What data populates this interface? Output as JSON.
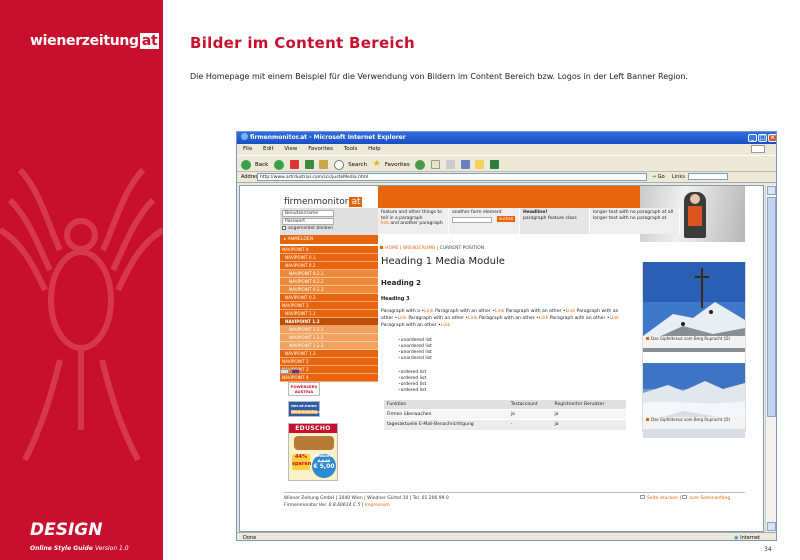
{
  "brand": {
    "logo_main": "wienerzeitung",
    "logo_suffix": "at"
  },
  "slide": {
    "title": "Bilder im Content Bereich",
    "description": "Die Homepage mit einem Beispiel für die Verwendung von Bildern im Content Bereich bzw. Logos in der Left Banner Region.",
    "design_label": "DESIGN",
    "guide_label": "Online Style Guide",
    "version": "Version 1.0",
    "page_number": "34"
  },
  "browser": {
    "title": "firmenmonitor.at - Microsoft Internet Explorer",
    "menu": [
      "File",
      "Edit",
      "View",
      "Favorites",
      "Tools",
      "Help"
    ],
    "toolbar": {
      "back": "Back",
      "search": "Search",
      "favorites": "Favorites"
    },
    "address_label": "Address",
    "address_value": "http://www.artrdustrial.com/scs/justeMedia.html",
    "go_label": "Go",
    "links_label": "Links",
    "status_text": "Done",
    "status_zone": "Internet"
  },
  "site": {
    "logo_main": "firmenmonitor",
    "logo_suffix": "at",
    "login": {
      "username_placeholder": "Benutzername",
      "password_placeholder": "Passwort",
      "remember": "angemeldet bleiben",
      "button": "ANMELDEN"
    },
    "teasers": [
      {
        "text": "feature and other things to tell in a paragraph",
        "link": "link",
        "tail": "and another paragraph"
      },
      {
        "text": "another form element",
        "button": "suchen"
      },
      {
        "title": "Headline!",
        "text": "paragraph feature class"
      },
      {
        "text": "longer text with no paragraph at all longer text with no paragraph at"
      }
    ],
    "breadcrumb": {
      "home": "HOME",
      "bread": "BREADCRUMB",
      "current": "CURRENT POSITION"
    },
    "nav": [
      {
        "label": "NAVIPOINT 0",
        "level": "l0"
      },
      {
        "label": "NAVIPOINT 0.1",
        "level": "l1"
      },
      {
        "label": "NAVIPOINT 0.2",
        "level": "l1"
      },
      {
        "label": "NAVIPOINT 0.2.1",
        "level": "l2"
      },
      {
        "label": "NAVIPOINT 0.2.2",
        "level": "l2"
      },
      {
        "label": "NAVIPOINT 0.2.3",
        "level": "l2"
      },
      {
        "label": "NAVIPOINT 0.3",
        "level": "l1"
      },
      {
        "label": "NAVIPOINT 1",
        "level": "l0"
      },
      {
        "label": "NAVIPOINT 1.1",
        "level": "l1"
      },
      {
        "label": "NAVIPOINT 1.2",
        "level": "l1-active"
      },
      {
        "label": "NAVIPOINT 1.2.1",
        "level": "l2-light"
      },
      {
        "label": "NAVIPOINT 1.2.2",
        "level": "l2-light"
      },
      {
        "label": "NAVIPOINT 1.2.3",
        "level": "l2-light"
      },
      {
        "label": "NAVIPOINT 1.3",
        "level": "l1"
      },
      {
        "label": "NAVIPOINT 2",
        "level": "l0"
      },
      {
        "label": "NAVIPOINT 3",
        "level": "l0"
      },
      {
        "label": "NAVIPOINT 4",
        "level": "l0"
      }
    ],
    "banners": {
      "powerserv_1": "POWERSERV",
      "powerserv_2": "AUSTRIA",
      "amt_1": "der.at.home",
      "amt_2": "Weihnachtsgeld",
      "eduscho_head": "EDUSCHO",
      "eduscho_pct": "44%",
      "eduscho_pct_sub": "sparen",
      "eduscho_old": "Bestkarte",
      "eduscho_price_old": "€ 8,99",
      "eduscho_price": "€ 5,00"
    },
    "content": {
      "heading1": "Heading 1 Media Module",
      "heading2": "Heading 2",
      "heading3": "Heading 3",
      "para_text": "Paragraph with a",
      "para_link": "Link",
      "para_mid": "Paragraph with an other",
      "unordered": [
        "unordered list",
        "unordered list",
        "unordered list",
        "unordered list"
      ],
      "ordered": [
        "ordered list",
        "ordered list",
        "ordered list",
        "ordered list"
      ],
      "table": {
        "headers": [
          "Funktion",
          "Testaccount",
          "Registrierter Benutzer"
        ],
        "rows": [
          [
            "Firmen überwachen",
            "ja",
            "ja"
          ],
          [
            "tagesaktuelle E-Mail-Benachrichtigung",
            "-",
            "ja"
          ]
        ]
      },
      "caption_1": "Das Gipfelkreuz vom Berg Rupracht (D)",
      "caption_2": "Das Gipfelkreuz vom Berg Rupracht (D)"
    },
    "footer": {
      "line1": "Wiener Zeitung GmbH | 1040 Wien | Wiedner Gürtel 10 | Tel. 01 206 99 0",
      "line2_text": "Firmenmonitor Ver. 0.8.60614 C 5 |",
      "line2_link": "Impressum",
      "print": "Seite drucken",
      "top": "zum Seitenanfang"
    }
  },
  "colors": {
    "brand_red": "#c8102e",
    "site_orange": "#e8650e"
  }
}
